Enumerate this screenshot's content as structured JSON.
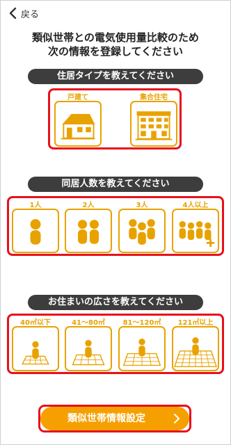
{
  "nav": {
    "back_label": "戻る"
  },
  "headline": {
    "line1": "類似世帯との電気使用量比較のため",
    "line2": "次の情報を登録してください"
  },
  "sections": {
    "housing": {
      "title": "住居タイプを教えてください",
      "options": [
        {
          "label": "戸建て",
          "icon": "house-icon"
        },
        {
          "label": "集合住宅",
          "icon": "apartment-icon"
        }
      ]
    },
    "household": {
      "title": "同居人数を教えてください",
      "options": [
        {
          "label": "1人",
          "icon": "one-person-icon"
        },
        {
          "label": "2人",
          "icon": "two-people-icon"
        },
        {
          "label": "3人",
          "icon": "three-people-icon"
        },
        {
          "label": "4人以上",
          "icon": "four-plus-people-icon"
        }
      ]
    },
    "area": {
      "title": "お住まいの広さを教えてください",
      "options": [
        {
          "label": "40㎡以下",
          "icon": "small-floor-icon"
        },
        {
          "label": "41～80㎡",
          "icon": "medium-floor-icon"
        },
        {
          "label": "81～120㎡",
          "icon": "large-floor-icon"
        },
        {
          "label": "121㎡以上",
          "icon": "xlarge-floor-icon"
        }
      ]
    }
  },
  "cta": {
    "label": "類似世帯情報設定"
  },
  "colors": {
    "accent": "#f5a000",
    "icon": "#e8a200",
    "highlight": "#e8101a",
    "pill": "#3d3d3d"
  }
}
